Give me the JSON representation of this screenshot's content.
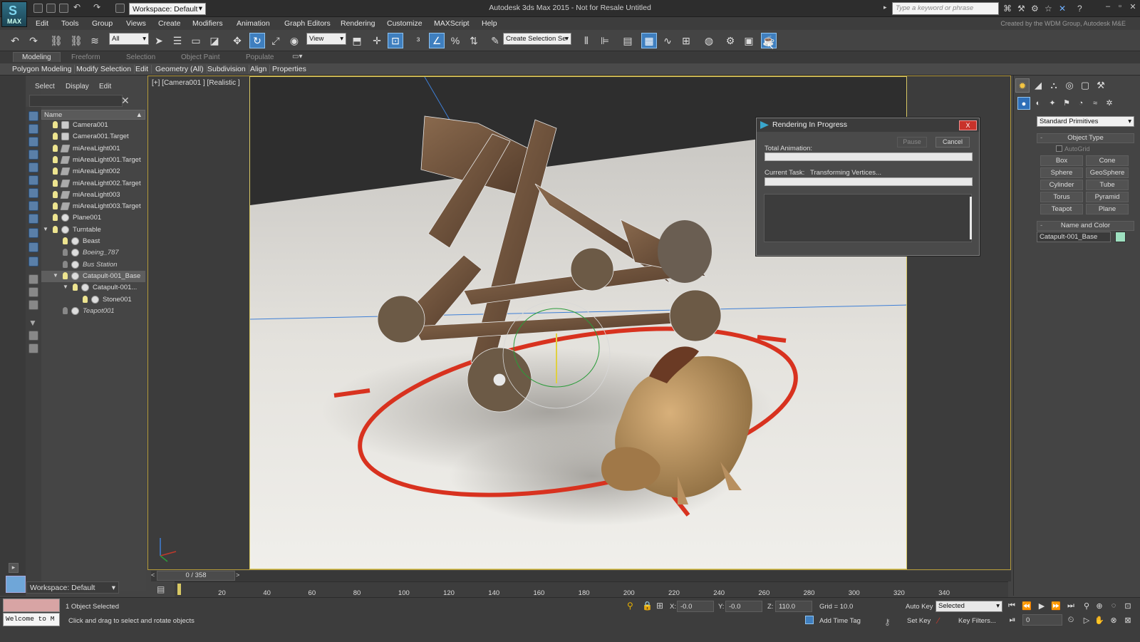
{
  "titlebar": {
    "logo_label": "MAX",
    "workspace": "Workspace: Default",
    "window_title": "Autodesk 3ds Max  2015   -  Not for Resale   Untitled",
    "search_placeholder": "Type a keyword or phrase"
  },
  "menu": {
    "items": [
      "Edit",
      "Tools",
      "Group",
      "Views",
      "Create",
      "Modifiers",
      "Animation",
      "Graph Editors",
      "Rendering",
      "Customize",
      "MAXScript",
      "Help"
    ],
    "credit": "Created by the WDM Group, Autodesk M&E"
  },
  "toolbar": {
    "selection_filter": "All",
    "ref_coord": "View",
    "named_selection": "Create Selection Se"
  },
  "ribbon": {
    "tabs": [
      "Modeling",
      "Freeform",
      "Selection",
      "Object Paint",
      "Populate"
    ],
    "panels": [
      "Polygon Modeling",
      "Modify Selection",
      "Edit",
      "Geometry (All)",
      "Subdivision",
      "Align",
      "Properties"
    ]
  },
  "explorer": {
    "menu": [
      "Select",
      "Display",
      "Edit"
    ],
    "column_header": "Name",
    "rows": [
      {
        "label": "Camera001",
        "type": "camera"
      },
      {
        "label": "Camera001.Target",
        "type": "camera"
      },
      {
        "label": "miAreaLight001",
        "type": "light"
      },
      {
        "label": "miAreaLight001.Target",
        "type": "light"
      },
      {
        "label": "miAreaLight002",
        "type": "light"
      },
      {
        "label": "miAreaLight002.Target",
        "type": "light"
      },
      {
        "label": "miAreaLight003",
        "type": "light"
      },
      {
        "label": "miAreaLight003.Target",
        "type": "light"
      },
      {
        "label": "Plane001",
        "type": "geo"
      },
      {
        "label": "Turntable",
        "type": "group"
      },
      {
        "label": "Beast",
        "type": "geo"
      },
      {
        "label": "Boeing_787",
        "type": "geo",
        "hidden": true
      },
      {
        "label": "Bus Station",
        "type": "geo",
        "hidden": true
      },
      {
        "label": "Catapult-001_Base",
        "type": "geo",
        "selected": true
      },
      {
        "label": "Catapult-001...",
        "type": "geo"
      },
      {
        "label": "Stone001",
        "type": "geo"
      },
      {
        "label": "Teapot001",
        "type": "geo",
        "hidden": true
      }
    ],
    "workspace": "Workspace: Default"
  },
  "viewport": {
    "label": "[+] [Camera001 ] [Realistic ]"
  },
  "render_dialog": {
    "title": "Rendering In Progress",
    "total_animation_label": "Total Animation:",
    "pause_label": "Pause",
    "cancel_label": "Cancel",
    "current_task_label": "Current Task:",
    "current_task_value": "Transforming Vertices...",
    "close_label": "X"
  },
  "command_panel": {
    "category": "Standard Primitives",
    "object_type_header": "Object Type",
    "autogrid_label": "AutoGrid",
    "primitives": [
      "Box",
      "Cone",
      "Sphere",
      "GeoSphere",
      "Cylinder",
      "Tube",
      "Torus",
      "Pyramid",
      "Teapot",
      "Plane"
    ],
    "name_color_header": "Name and Color",
    "object_name": "Catapult-001_Base",
    "object_color": "#9ee0c0"
  },
  "timeline": {
    "frame_counter": "0 / 358",
    "ticks": [
      "20",
      "40",
      "60",
      "80",
      "100",
      "120",
      "140",
      "160",
      "180",
      "200",
      "220",
      "240",
      "260",
      "280",
      "300",
      "320",
      "340"
    ]
  },
  "status": {
    "maxscript_output": "Welcome to M",
    "selection_status": "1 Object Selected",
    "prompt": "Click and drag to select and rotate objects",
    "x_label": "X:",
    "x_value": "-0.0",
    "y_label": "Y:",
    "y_value": "-0.0",
    "z_label": "Z:",
    "z_value": "110.0",
    "grid": "Grid = 10.0",
    "auto_key": "Auto Key",
    "key_mode": "Selected",
    "set_key": "Set Key",
    "key_filters": "Key Filters...",
    "add_time_tag": "Add Time Tag",
    "current_frame": "0"
  }
}
